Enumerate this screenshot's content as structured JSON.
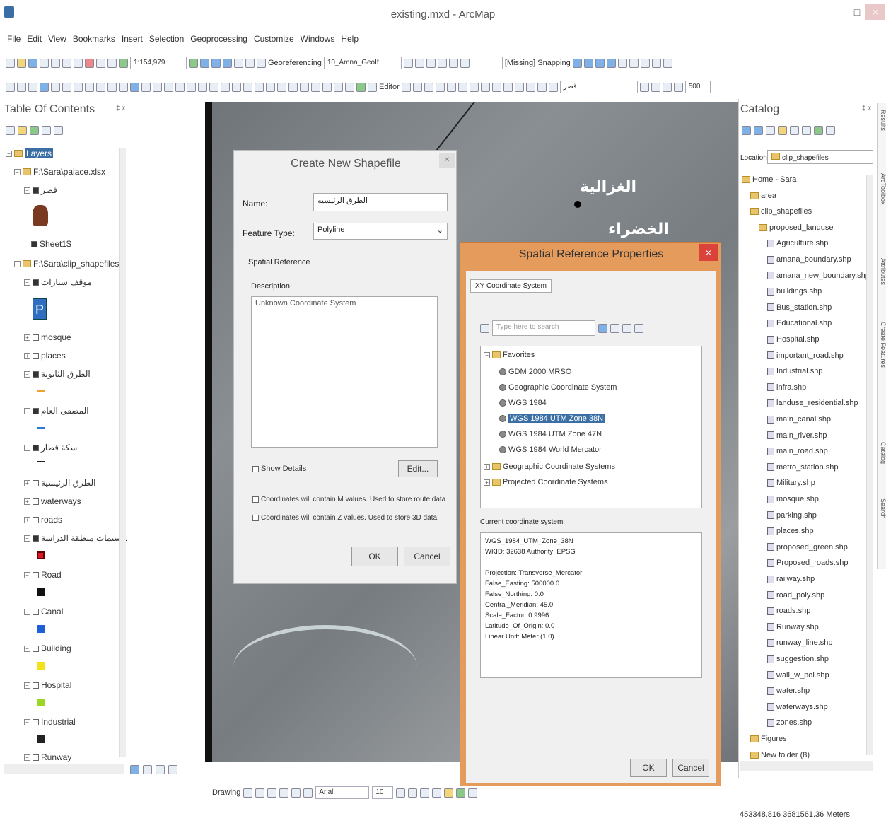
{
  "window": {
    "title": "existing.mxd - ArcMap"
  },
  "menu": [
    "File",
    "Edit",
    "View",
    "Bookmarks",
    "Insert",
    "Selection",
    "Geoprocessing",
    "Customize",
    "Windows",
    "Help"
  ],
  "toolbar": {
    "scale": "1:154,979",
    "georef_label": "Georeferencing",
    "georef_layer": "10_Amna_GeoIf",
    "missing": "[Missing]",
    "snapping": "Snapping",
    "editor": "Editor",
    "layer_combo": "قصر",
    "zoom_value": "500"
  },
  "toc": {
    "title": "Table Of Contents",
    "items": [
      {
        "label": "Layers",
        "depth": 0
      },
      {
        "label": "F:\\Sara\\palace.xlsx",
        "depth": 1
      },
      {
        "label": "قصر",
        "depth": 2
      },
      {
        "label": "Sheet1$",
        "depth": 2
      },
      {
        "label": "F:\\Sara\\clip_shapefiles",
        "depth": 1
      },
      {
        "label": "موقف سيارات",
        "depth": 2
      },
      {
        "label": "mosque",
        "depth": 2
      },
      {
        "label": "places",
        "depth": 2
      },
      {
        "label": "الطرق الثانوية",
        "depth": 2
      },
      {
        "label": "المصفى العام",
        "depth": 2
      },
      {
        "label": "سكة قطار",
        "depth": 2
      },
      {
        "label": "الطرق الرئيسية",
        "depth": 2
      },
      {
        "label": "waterways",
        "depth": 2
      },
      {
        "label": "roads",
        "depth": 2
      },
      {
        "label": "تقسيمات منطقة الدراسة",
        "depth": 2
      },
      {
        "label": "Road",
        "depth": 2
      },
      {
        "label": "Canal",
        "depth": 2
      },
      {
        "label": "Building",
        "depth": 2
      },
      {
        "label": "Hospital",
        "depth": 2
      },
      {
        "label": "Industrial",
        "depth": 2
      },
      {
        "label": "Runway",
        "depth": 2
      }
    ]
  },
  "map": {
    "label1": "الغزالية",
    "label2": "الخضراء"
  },
  "catalog": {
    "title": "Catalog",
    "location_label": "Location:",
    "location_value": "clip_shapefiles",
    "items": [
      "Home - Sara",
      "area",
      "clip_shapefiles",
      "proposed_landuse",
      "Agriculture.shp",
      "amana_boundary.shp",
      "amana_new_boundary.shp",
      "buildings.shp",
      "Bus_station.shp",
      "Educational.shp",
      "Hospital.shp",
      "important_road.shp",
      "Industrial.shp",
      "infra.shp",
      "landuse_residential.shp",
      "main_canal.shp",
      "main_river.shp",
      "main_road.shp",
      "metro_station.shp",
      "Military.shp",
      "mosque.shp",
      "parking.shp",
      "places.shp",
      "proposed_green.shp",
      "Proposed_roads.shp",
      "railway.shp",
      "road_poly.shp",
      "roads.shp",
      "Runway.shp",
      "runway_line.shp",
      "suggestion.shp",
      "wall_w_pol.shp",
      "water.shp",
      "waterways.shp",
      "zones.shp",
      "Figures",
      "New folder (8)"
    ]
  },
  "sidetabs": [
    "Results",
    "ArcToolbox",
    "Attributes",
    "Create Features",
    "Catalog",
    "Search"
  ],
  "create_dialog": {
    "title": "Create New Shapefile",
    "name_label": "Name:",
    "name_value": "الطرق الرئيسية",
    "feature_type_label": "Feature Type:",
    "feature_type_value": "Polyline",
    "spatial_ref_label": "Spatial Reference",
    "description_label": "Description:",
    "description_value": "Unknown Coordinate System",
    "show_details": "Show Details",
    "edit": "Edit...",
    "m_values": "Coordinates will contain M values. Used to store route data.",
    "z_values": "Coordinates will contain Z values. Used to store 3D data.",
    "ok": "OK",
    "cancel": "Cancel"
  },
  "spatial_dialog": {
    "title": "Spatial Reference Properties",
    "tab": "XY Coordinate System",
    "search_placeholder": "Type here to search",
    "tree": [
      "Favorites",
      "GDM 2000 MRSO",
      "Geographic Coordinate System",
      "WGS 1984",
      "WGS 1984 UTM Zone 38N",
      "WGS 1984 UTM Zone 47N",
      "WGS 1984 World Mercator",
      "Geographic Coordinate Systems",
      "Projected Coordinate Systems"
    ],
    "current_label": "Current coordinate system:",
    "current_lines": [
      "WGS_1984_UTM_Zone_38N",
      "WKID: 32638 Authority: EPSG",
      "",
      "Projection: Transverse_Mercator",
      "False_Easting: 500000.0",
      "False_Northing: 0.0",
      "Central_Meridian: 45.0",
      "Scale_Factor: 0.9996",
      "Latitude_Of_Origin: 0.0",
      "Linear Unit: Meter (1.0)"
    ],
    "ok": "OK",
    "cancel": "Cancel"
  },
  "drawing": {
    "label": "Drawing",
    "font": "Arial",
    "size": "10"
  },
  "status": {
    "coords": "453348.816 3681561.36 Meters"
  }
}
